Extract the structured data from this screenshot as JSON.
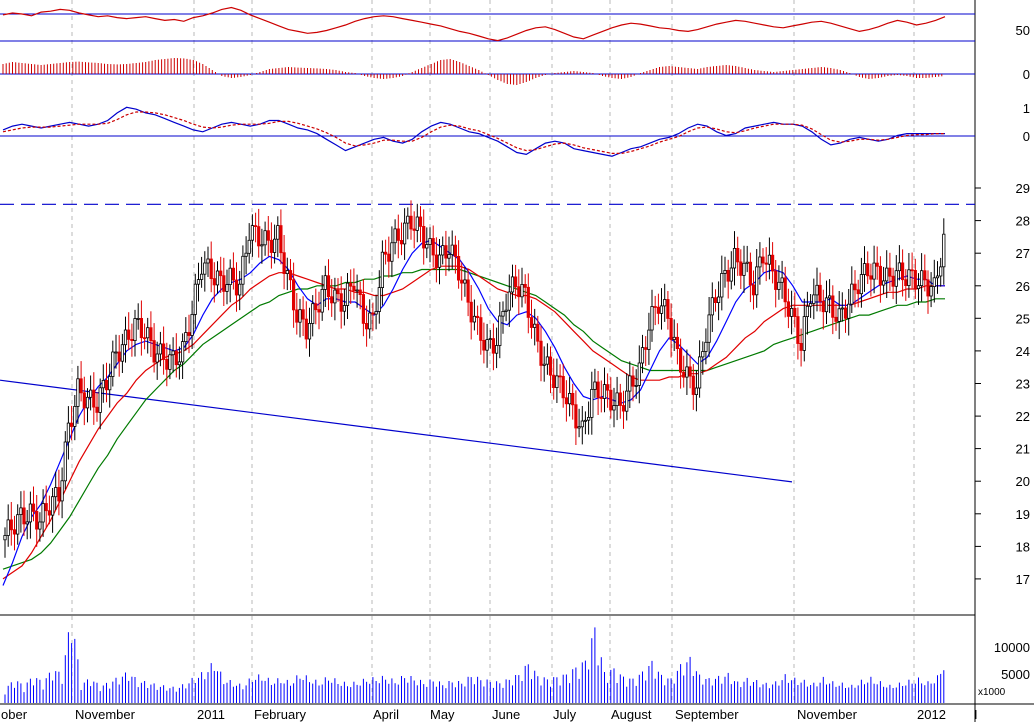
{
  "colors": {
    "up": "#000000",
    "down": "#e00000",
    "ma_short": "#0000ff",
    "ma_mid": "#e00000",
    "ma_long": "#007a00",
    "line": "#0000cc",
    "volume": "#0000ff",
    "indicator": "#cc0000",
    "grid": "#b8b8b8"
  },
  "chart_data": [
    {
      "type": "line",
      "panel": "rsi",
      "yticks": [
        "50"
      ],
      "reference_value": 50,
      "ylim": [
        28,
        78
      ],
      "x_range": [
        0,
        945
      ],
      "values": [
        64,
        66,
        65,
        63,
        67,
        68,
        70,
        69,
        66,
        64,
        62,
        63,
        61,
        60,
        61,
        62,
        60,
        58,
        59,
        57,
        61,
        63,
        66,
        70,
        72,
        69,
        64,
        60,
        56,
        52,
        48,
        46,
        44,
        45,
        47,
        50,
        53,
        57,
        60,
        62,
        63,
        62,
        60,
        58,
        56,
        54,
        52,
        49,
        46,
        44,
        41,
        38,
        36,
        39,
        43,
        47,
        50,
        51,
        48,
        44,
        40,
        38,
        42,
        46,
        50,
        53,
        55,
        54,
        52,
        50,
        49,
        47,
        46,
        48,
        51,
        54,
        56,
        58,
        57,
        55,
        53,
        51,
        50,
        52,
        54,
        56,
        57,
        55,
        52,
        49,
        46,
        48,
        51,
        55,
        58,
        56,
        53,
        55,
        58,
        62
      ]
    },
    {
      "type": "bar",
      "panel": "macd_hist",
      "yticks": [
        "0"
      ],
      "ylim": [
        -1,
        1
      ],
      "x_range": [
        0,
        945
      ],
      "values": [
        0.5,
        0.6,
        0.55,
        0.5,
        0.45,
        0.5,
        0.55,
        0.6,
        0.62,
        0.58,
        0.55,
        0.5,
        0.48,
        0.5,
        0.55,
        0.6,
        0.7,
        0.75,
        0.8,
        0.78,
        0.7,
        0.5,
        0.2,
        -0.1,
        -0.2,
        -0.15,
        -0.05,
        0.1,
        0.25,
        0.3,
        0.35,
        0.32,
        0.3,
        0.28,
        0.25,
        0.2,
        0.1,
        0.05,
        -0.1,
        -0.2,
        -0.25,
        -0.2,
        -0.1,
        0.1,
        0.3,
        0.5,
        0.7,
        0.75,
        0.6,
        0.4,
        0.2,
        -0.05,
        -0.3,
        -0.5,
        -0.55,
        -0.4,
        -0.2,
        -0.05,
        0.05,
        0.1,
        0.15,
        0.1,
        0.05,
        -0.1,
        -0.2,
        -0.25,
        -0.15,
        0.05,
        0.2,
        0.35,
        0.4,
        0.35,
        0.3,
        0.25,
        0.35,
        0.4,
        0.45,
        0.4,
        0.3,
        0.2,
        0.15,
        0.1,
        0.15,
        0.2,
        0.25,
        0.3,
        0.35,
        0.3,
        0.2,
        0.05,
        -0.15,
        -0.25,
        -0.2,
        -0.1,
        -0.05,
        -0.1,
        -0.2,
        -0.2,
        -0.15,
        -0.1
      ]
    },
    {
      "type": "line",
      "panel": "macd",
      "yticks": [
        "1",
        "0"
      ],
      "ylim": [
        -1.2,
        2.2
      ],
      "x_range": [
        0,
        945
      ],
      "series": [
        {
          "color_key": "line",
          "values": [
            0.4,
            0.6,
            0.7,
            0.6,
            0.5,
            0.6,
            0.7,
            0.8,
            0.7,
            0.6,
            0.7,
            0.9,
            1.3,
            1.6,
            1.5,
            1.3,
            1.2,
            1.0,
            0.8,
            0.6,
            0.4,
            0.3,
            0.5,
            0.7,
            0.8,
            0.7,
            0.6,
            0.7,
            0.9,
            0.9,
            0.7,
            0.5,
            0.4,
            0.2,
            -0.1,
            -0.4,
            -0.7,
            -0.5,
            -0.3,
            -0.1,
            0.0,
            -0.2,
            -0.3,
            -0.1,
            0.3,
            0.6,
            0.8,
            0.7,
            0.5,
            0.3,
            0.2,
            0.0,
            -0.2,
            -0.5,
            -0.8,
            -0.9,
            -0.6,
            -0.3,
            -0.2,
            -0.3,
            -0.6,
            -0.7,
            -0.8,
            -0.9,
            -1.0,
            -0.8,
            -0.6,
            -0.5,
            -0.3,
            -0.1,
            0.0,
            0.2,
            0.5,
            0.7,
            0.6,
            0.3,
            0.1,
            0.2,
            0.5,
            0.6,
            0.7,
            0.8,
            0.7,
            0.7,
            0.6,
            0.3,
            -0.1,
            -0.4,
            -0.3,
            -0.1,
            0.0,
            -0.1,
            -0.2,
            -0.1,
            0.1,
            0.2,
            0.2,
            0.2,
            0.2,
            0.2
          ]
        },
        {
          "color_key": "indicator",
          "values": [
            0.3,
            0.4,
            0.5,
            0.55,
            0.55,
            0.55,
            0.6,
            0.65,
            0.7,
            0.7,
            0.7,
            0.75,
            0.95,
            1.2,
            1.35,
            1.35,
            1.3,
            1.2,
            1.05,
            0.9,
            0.7,
            0.55,
            0.5,
            0.55,
            0.65,
            0.7,
            0.7,
            0.7,
            0.75,
            0.85,
            0.85,
            0.75,
            0.6,
            0.45,
            0.25,
            0.0,
            -0.3,
            -0.45,
            -0.4,
            -0.3,
            -0.15,
            -0.15,
            -0.2,
            -0.2,
            0.0,
            0.3,
            0.55,
            0.65,
            0.6,
            0.45,
            0.35,
            0.15,
            -0.05,
            -0.3,
            -0.55,
            -0.7,
            -0.65,
            -0.5,
            -0.35,
            -0.3,
            -0.4,
            -0.55,
            -0.65,
            -0.75,
            -0.85,
            -0.85,
            -0.75,
            -0.6,
            -0.45,
            -0.25,
            -0.1,
            0.05,
            0.3,
            0.5,
            0.55,
            0.45,
            0.3,
            0.25,
            0.35,
            0.5,
            0.6,
            0.7,
            0.7,
            0.7,
            0.65,
            0.45,
            0.15,
            -0.15,
            -0.25,
            -0.2,
            -0.1,
            -0.1,
            -0.15,
            -0.1,
            0.0,
            0.1,
            0.15,
            0.15,
            0.2,
            0.2
          ]
        }
      ]
    },
    {
      "type": "line",
      "panel": "price",
      "yticks": [
        "29",
        "28",
        "27",
        "26",
        "25",
        "24",
        "23",
        "22",
        "21",
        "20",
        "19",
        "18",
        "17"
      ],
      "ylim": [
        16.2,
        29.4
      ],
      "x_range": [
        0,
        945
      ],
      "resistance_level": 28.5,
      "close": [
        18.2,
        18.6,
        18.9,
        19.0,
        18.8,
        19.3,
        19.6,
        21.6,
        22.8,
        22.5,
        22.4,
        23.1,
        23.9,
        24.3,
        24.8,
        24.6,
        24.0,
        23.8,
        23.7,
        24.0,
        25.2,
        26.7,
        26.4,
        26.1,
        26.2,
        26.0,
        27.7,
        27.5,
        27.3,
        27.5,
        26.3,
        25.1,
        24.7,
        25.3,
        26.0,
        25.6,
        25.5,
        26.2,
        25.0,
        24.9,
        26.7,
        27.3,
        27.6,
        28.0,
        27.7,
        27.1,
        26.8,
        27.2,
        26.5,
        25.5,
        24.7,
        24.1,
        24.3,
        25.6,
        26.1,
        25.7,
        24.5,
        23.6,
        23.2,
        22.8,
        22.2,
        21.5,
        22.7,
        22.8,
        22.5,
        22.3,
        22.9,
        23.4,
        24.8,
        25.5,
        25.1,
        23.8,
        23.2,
        22.9,
        24.6,
        25.7,
        26.3,
        26.8,
        26.6,
        26.0,
        27.0,
        26.4,
        25.9,
        25.1,
        24.2,
        25.8,
        25.6,
        25.4,
        25.0,
        25.5,
        26.1,
        26.5,
        26.4,
        26.2,
        26.4,
        26.3,
        26.2,
        26.1,
        25.9,
        27.4
      ],
      "series": [
        {
          "color_key": "ma_short",
          "values": [
            16.8,
            17.5,
            18.3,
            18.9,
            19.3,
            19.9,
            20.6,
            21.3,
            22.0,
            22.5,
            22.9,
            23.2,
            23.6,
            24.0,
            24.2,
            24.3,
            24.2,
            24.1,
            24.0,
            24.1,
            24.5,
            25.1,
            25.6,
            25.9,
            26.1,
            26.2,
            26.4,
            26.7,
            26.9,
            26.8,
            26.5,
            26.0,
            25.6,
            25.4,
            25.6,
            25.6,
            25.5,
            25.5,
            25.3,
            25.1,
            25.4,
            25.9,
            26.5,
            27.0,
            27.3,
            27.4,
            27.2,
            27.0,
            26.8,
            26.4,
            25.9,
            25.3,
            24.9,
            24.8,
            25.1,
            25.2,
            25.0,
            24.6,
            24.1,
            23.5,
            23.0,
            22.6,
            22.5,
            22.6,
            22.5,
            22.4,
            22.5,
            22.8,
            23.4,
            24.0,
            24.4,
            24.2,
            23.9,
            23.6,
            23.8,
            24.3,
            24.9,
            25.5,
            25.9,
            26.1,
            26.4,
            26.5,
            26.4,
            26.0,
            25.5,
            25.5,
            25.5,
            25.6,
            25.4,
            25.4,
            25.6,
            25.8,
            26.0,
            26.1,
            26.2,
            26.3,
            26.2,
            26.2,
            26.0,
            26.0
          ]
        },
        {
          "color_key": "ma_mid",
          "values": [
            17.0,
            17.2,
            17.4,
            17.8,
            18.3,
            18.8,
            19.4,
            20.0,
            20.6,
            21.1,
            21.6,
            22.0,
            22.4,
            22.7,
            23.1,
            23.4,
            23.6,
            23.8,
            23.9,
            24.0,
            24.2,
            24.5,
            24.8,
            25.1,
            25.4,
            25.6,
            25.9,
            26.1,
            26.3,
            26.4,
            26.4,
            26.3,
            26.2,
            26.1,
            26.0,
            25.9,
            25.9,
            25.8,
            25.8,
            25.7,
            25.7,
            25.8,
            25.9,
            26.1,
            26.3,
            26.5,
            26.6,
            26.6,
            26.6,
            26.5,
            26.3,
            26.1,
            25.9,
            25.8,
            25.7,
            25.7,
            25.6,
            25.4,
            25.2,
            24.9,
            24.6,
            24.3,
            24.0,
            23.8,
            23.6,
            23.4,
            23.2,
            23.1,
            23.1,
            23.1,
            23.2,
            23.2,
            23.3,
            23.3,
            23.4,
            23.6,
            23.8,
            24.1,
            24.4,
            24.6,
            24.9,
            25.1,
            25.3,
            25.4,
            25.4,
            25.4,
            25.4,
            25.4,
            25.4,
            25.4,
            25.5,
            25.6,
            25.7,
            25.8,
            25.8,
            25.9,
            25.9,
            26.0,
            26.0,
            26.0
          ]
        },
        {
          "color_key": "ma_long",
          "values": [
            17.3,
            17.4,
            17.5,
            17.6,
            17.8,
            18.1,
            18.5,
            18.9,
            19.4,
            19.9,
            20.4,
            20.8,
            21.3,
            21.7,
            22.1,
            22.5,
            22.8,
            23.1,
            23.4,
            23.6,
            23.9,
            24.2,
            24.4,
            24.6,
            24.8,
            25.0,
            25.2,
            25.4,
            25.5,
            25.7,
            25.8,
            25.9,
            25.9,
            26.0,
            26.0,
            26.0,
            26.1,
            26.1,
            26.2,
            26.2,
            26.3,
            26.3,
            26.4,
            26.4,
            26.5,
            26.5,
            26.5,
            26.5,
            26.5,
            26.4,
            26.3,
            26.2,
            26.1,
            26.0,
            25.9,
            25.8,
            25.7,
            25.5,
            25.3,
            25.1,
            24.8,
            24.6,
            24.3,
            24.1,
            23.9,
            23.7,
            23.6,
            23.5,
            23.4,
            23.4,
            23.4,
            23.4,
            23.4,
            23.4,
            23.4,
            23.5,
            23.6,
            23.7,
            23.8,
            23.9,
            24.0,
            24.2,
            24.3,
            24.4,
            24.5,
            24.6,
            24.7,
            24.8,
            24.9,
            25.0,
            25.1,
            25.1,
            25.2,
            25.3,
            25.4,
            25.4,
            25.5,
            25.5,
            25.6,
            25.6
          ]
        }
      ]
    },
    {
      "type": "bar",
      "panel": "volume",
      "yticks": [
        "10000",
        "5000"
      ],
      "unit": "x1000",
      "ylim": [
        0,
        14000
      ],
      "x_range": [
        0,
        945
      ],
      "values": [
        2000,
        3500,
        2500,
        4000,
        3000,
        5000,
        4200,
        13000,
        2800,
        3600,
        2500,
        3000,
        3800,
        4500,
        3200,
        3000,
        2600,
        2400,
        2200,
        2800,
        3800,
        4500,
        6000,
        3500,
        3000,
        2500,
        3800,
        4000,
        3200,
        3500,
        3000,
        4200,
        3600,
        3000,
        3800,
        3200,
        2800,
        3000,
        3500,
        3600,
        3800,
        3200,
        4000,
        3600,
        3000,
        3400,
        2800,
        3200,
        3000,
        4000,
        3500,
        3200,
        3000,
        3500,
        4200,
        5800,
        4000,
        3500,
        3800,
        4200,
        5200,
        6200,
        11000,
        4500,
        5000,
        3800,
        3500,
        4500,
        6000,
        4000,
        3500,
        5500,
        6500,
        4000,
        3500,
        3800,
        4200,
        3000,
        3500,
        3200,
        2800,
        3000,
        4000,
        3500,
        3200,
        2800,
        3600,
        3000,
        2800,
        2500,
        3200,
        3600,
        3000,
        2500,
        2800,
        3200,
        3500,
        3000,
        3800,
        7000
      ]
    }
  ],
  "x_axis": {
    "months": [
      "ober",
      "November",
      "2011",
      "February",
      "April",
      "May",
      "June",
      "July",
      "August",
      "September",
      "November",
      "2012",
      "I"
    ]
  }
}
